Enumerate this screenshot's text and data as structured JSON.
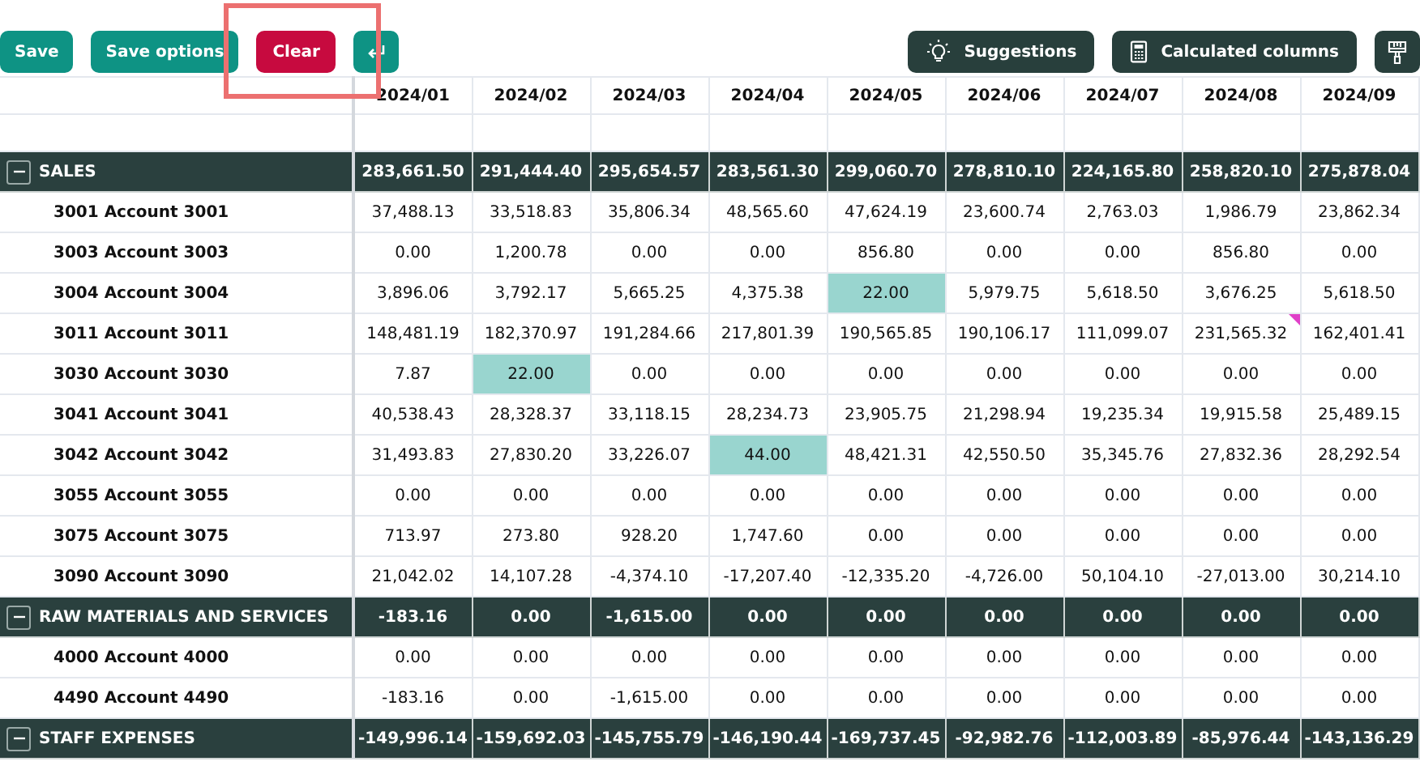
{
  "toolbar": {
    "left_buttons": [
      {
        "label": "Save",
        "kind": "primary",
        "highlighted": false
      },
      {
        "label": "Save options",
        "kind": "primary",
        "highlighted": false
      },
      {
        "label": "Clear",
        "kind": "danger",
        "highlighted": true
      },
      {
        "kind": "return-icon",
        "highlighted": false
      }
    ],
    "right_buttons": [
      {
        "label": "Suggestions",
        "kind": "bulb",
        "highlighted": false
      },
      {
        "label": "Calculated columns",
        "kind": "calculator",
        "highlighted": false
      },
      {
        "kind": "brush",
        "highlighted": false
      }
    ]
  },
  "table": {
    "columns": [
      "2024/01",
      "2024/02",
      "2024/03",
      "2024/04",
      "2024/05",
      "2024/06",
      "2024/07",
      "2024/08",
      "2024/09"
    ],
    "rows": [
      {
        "kind": "group",
        "label": "SALES",
        "expanded": true,
        "cells": [
          {
            "value": "283,661.50",
            "edited": false,
            "note": false
          },
          {
            "value": "291,444.40",
            "edited": false,
            "note": false
          },
          {
            "value": "295,654.57",
            "edited": false,
            "note": false
          },
          {
            "value": "283,561.30",
            "edited": false,
            "note": false
          },
          {
            "value": "299,060.70",
            "edited": false,
            "note": false
          },
          {
            "value": "278,810.10",
            "edited": false,
            "note": false
          },
          {
            "value": "224,165.80",
            "edited": false,
            "note": false
          },
          {
            "value": "258,820.10",
            "edited": false,
            "note": false
          },
          {
            "value": "275,878.04",
            "edited": false,
            "note": false
          }
        ]
      },
      {
        "kind": "account",
        "label": "3001 Account 3001",
        "cells": [
          {
            "value": "37,488.13",
            "edited": false,
            "note": false
          },
          {
            "value": "33,518.83",
            "edited": false,
            "note": false
          },
          {
            "value": "35,806.34",
            "edited": false,
            "note": false
          },
          {
            "value": "48,565.60",
            "edited": false,
            "note": false
          },
          {
            "value": "47,624.19",
            "edited": false,
            "note": false
          },
          {
            "value": "23,600.74",
            "edited": false,
            "note": false
          },
          {
            "value": "2,763.03",
            "edited": false,
            "note": false
          },
          {
            "value": "1,986.79",
            "edited": false,
            "note": false
          },
          {
            "value": "23,862.34",
            "edited": false,
            "note": false
          }
        ]
      },
      {
        "kind": "account",
        "label": "3003 Account 3003",
        "cells": [
          {
            "value": "0.00",
            "edited": false,
            "note": false
          },
          {
            "value": "1,200.78",
            "edited": false,
            "note": false
          },
          {
            "value": "0.00",
            "edited": false,
            "note": false
          },
          {
            "value": "0.00",
            "edited": false,
            "note": false
          },
          {
            "value": "856.80",
            "edited": false,
            "note": false
          },
          {
            "value": "0.00",
            "edited": false,
            "note": false
          },
          {
            "value": "0.00",
            "edited": false,
            "note": false
          },
          {
            "value": "856.80",
            "edited": false,
            "note": false
          },
          {
            "value": "0.00",
            "edited": false,
            "note": false
          }
        ]
      },
      {
        "kind": "account",
        "label": "3004 Account 3004",
        "cells": [
          {
            "value": "3,896.06",
            "edited": false,
            "note": false
          },
          {
            "value": "3,792.17",
            "edited": false,
            "note": false
          },
          {
            "value": "5,665.25",
            "edited": false,
            "note": false
          },
          {
            "value": "4,375.38",
            "edited": false,
            "note": false
          },
          {
            "value": "22.00",
            "edited": true,
            "note": false
          },
          {
            "value": "5,979.75",
            "edited": false,
            "note": false
          },
          {
            "value": "5,618.50",
            "edited": false,
            "note": false
          },
          {
            "value": "3,676.25",
            "edited": false,
            "note": false
          },
          {
            "value": "5,618.50",
            "edited": false,
            "note": false
          }
        ]
      },
      {
        "kind": "account",
        "label": "3011 Account 3011",
        "cells": [
          {
            "value": "148,481.19",
            "edited": false,
            "note": false
          },
          {
            "value": "182,370.97",
            "edited": false,
            "note": false
          },
          {
            "value": "191,284.66",
            "edited": false,
            "note": false
          },
          {
            "value": "217,801.39",
            "edited": false,
            "note": false
          },
          {
            "value": "190,565.85",
            "edited": false,
            "note": false
          },
          {
            "value": "190,106.17",
            "edited": false,
            "note": false
          },
          {
            "value": "111,099.07",
            "edited": false,
            "note": false
          },
          {
            "value": "231,565.32",
            "edited": false,
            "note": true
          },
          {
            "value": "162,401.41",
            "edited": false,
            "note": false
          }
        ]
      },
      {
        "kind": "account",
        "label": "3030 Account 3030",
        "cells": [
          {
            "value": "7.87",
            "edited": false,
            "note": false
          },
          {
            "value": "22.00",
            "edited": true,
            "note": false
          },
          {
            "value": "0.00",
            "edited": false,
            "note": false
          },
          {
            "value": "0.00",
            "edited": false,
            "note": false
          },
          {
            "value": "0.00",
            "edited": false,
            "note": false
          },
          {
            "value": "0.00",
            "edited": false,
            "note": false
          },
          {
            "value": "0.00",
            "edited": false,
            "note": false
          },
          {
            "value": "0.00",
            "edited": false,
            "note": false
          },
          {
            "value": "0.00",
            "edited": false,
            "note": false
          }
        ]
      },
      {
        "kind": "account",
        "label": "3041 Account 3041",
        "cells": [
          {
            "value": "40,538.43",
            "edited": false,
            "note": false
          },
          {
            "value": "28,328.37",
            "edited": false,
            "note": false
          },
          {
            "value": "33,118.15",
            "edited": false,
            "note": false
          },
          {
            "value": "28,234.73",
            "edited": false,
            "note": false
          },
          {
            "value": "23,905.75",
            "edited": false,
            "note": false
          },
          {
            "value": "21,298.94",
            "edited": false,
            "note": false
          },
          {
            "value": "19,235.34",
            "edited": false,
            "note": false
          },
          {
            "value": "19,915.58",
            "edited": false,
            "note": false
          },
          {
            "value": "25,489.15",
            "edited": false,
            "note": false
          }
        ]
      },
      {
        "kind": "account",
        "label": "3042 Account 3042",
        "cells": [
          {
            "value": "31,493.83",
            "edited": false,
            "note": false
          },
          {
            "value": "27,830.20",
            "edited": false,
            "note": false
          },
          {
            "value": "33,226.07",
            "edited": false,
            "note": false
          },
          {
            "value": "44.00",
            "edited": true,
            "note": false
          },
          {
            "value": "48,421.31",
            "edited": false,
            "note": false
          },
          {
            "value": "42,550.50",
            "edited": false,
            "note": false
          },
          {
            "value": "35,345.76",
            "edited": false,
            "note": false
          },
          {
            "value": "27,832.36",
            "edited": false,
            "note": false
          },
          {
            "value": "28,292.54",
            "edited": false,
            "note": false
          }
        ]
      },
      {
        "kind": "account",
        "label": "3055 Account 3055",
        "cells": [
          {
            "value": "0.00",
            "edited": false,
            "note": false
          },
          {
            "value": "0.00",
            "edited": false,
            "note": false
          },
          {
            "value": "0.00",
            "edited": false,
            "note": false
          },
          {
            "value": "0.00",
            "edited": false,
            "note": false
          },
          {
            "value": "0.00",
            "edited": false,
            "note": false
          },
          {
            "value": "0.00",
            "edited": false,
            "note": false
          },
          {
            "value": "0.00",
            "edited": false,
            "note": false
          },
          {
            "value": "0.00",
            "edited": false,
            "note": false
          },
          {
            "value": "0.00",
            "edited": false,
            "note": false
          }
        ]
      },
      {
        "kind": "account",
        "label": "3075 Account 3075",
        "cells": [
          {
            "value": "713.97",
            "edited": false,
            "note": false
          },
          {
            "value": "273.80",
            "edited": false,
            "note": false
          },
          {
            "value": "928.20",
            "edited": false,
            "note": false
          },
          {
            "value": "1,747.60",
            "edited": false,
            "note": false
          },
          {
            "value": "0.00",
            "edited": false,
            "note": false
          },
          {
            "value": "0.00",
            "edited": false,
            "note": false
          },
          {
            "value": "0.00",
            "edited": false,
            "note": false
          },
          {
            "value": "0.00",
            "edited": false,
            "note": false
          },
          {
            "value": "0.00",
            "edited": false,
            "note": false
          }
        ]
      },
      {
        "kind": "account",
        "label": "3090 Account 3090",
        "cells": [
          {
            "value": "21,042.02",
            "edited": false,
            "note": false
          },
          {
            "value": "14,107.28",
            "edited": false,
            "note": false
          },
          {
            "value": "-4,374.10",
            "edited": false,
            "note": false
          },
          {
            "value": "-17,207.40",
            "edited": false,
            "note": false
          },
          {
            "value": "-12,335.20",
            "edited": false,
            "note": false
          },
          {
            "value": "-4,726.00",
            "edited": false,
            "note": false
          },
          {
            "value": "50,104.10",
            "edited": false,
            "note": false
          },
          {
            "value": "-27,013.00",
            "edited": false,
            "note": false
          },
          {
            "value": "30,214.10",
            "edited": false,
            "note": false
          }
        ]
      },
      {
        "kind": "group",
        "label": "RAW MATERIALS AND SERVICES",
        "expanded": true,
        "cells": [
          {
            "value": "-183.16",
            "edited": false,
            "note": false
          },
          {
            "value": "0.00",
            "edited": false,
            "note": false
          },
          {
            "value": "-1,615.00",
            "edited": false,
            "note": false
          },
          {
            "value": "0.00",
            "edited": false,
            "note": false
          },
          {
            "value": "0.00",
            "edited": false,
            "note": false
          },
          {
            "value": "0.00",
            "edited": false,
            "note": false
          },
          {
            "value": "0.00",
            "edited": false,
            "note": false
          },
          {
            "value": "0.00",
            "edited": false,
            "note": false
          },
          {
            "value": "0.00",
            "edited": false,
            "note": false
          }
        ]
      },
      {
        "kind": "account",
        "label": "4000 Account 4000",
        "cells": [
          {
            "value": "0.00",
            "edited": false,
            "note": false
          },
          {
            "value": "0.00",
            "edited": false,
            "note": false
          },
          {
            "value": "0.00",
            "edited": false,
            "note": false
          },
          {
            "value": "0.00",
            "edited": false,
            "note": false
          },
          {
            "value": "0.00",
            "edited": false,
            "note": false
          },
          {
            "value": "0.00",
            "edited": false,
            "note": false
          },
          {
            "value": "0.00",
            "edited": false,
            "note": false
          },
          {
            "value": "0.00",
            "edited": false,
            "note": false
          },
          {
            "value": "0.00",
            "edited": false,
            "note": false
          }
        ]
      },
      {
        "kind": "account",
        "label": "4490 Account 4490",
        "cells": [
          {
            "value": "-183.16",
            "edited": false,
            "note": false
          },
          {
            "value": "0.00",
            "edited": false,
            "note": false
          },
          {
            "value": "-1,615.00",
            "edited": false,
            "note": false
          },
          {
            "value": "0.00",
            "edited": false,
            "note": false
          },
          {
            "value": "0.00",
            "edited": false,
            "note": false
          },
          {
            "value": "0.00",
            "edited": false,
            "note": false
          },
          {
            "value": "0.00",
            "edited": false,
            "note": false
          },
          {
            "value": "0.00",
            "edited": false,
            "note": false
          },
          {
            "value": "0.00",
            "edited": false,
            "note": false
          }
        ]
      },
      {
        "kind": "group",
        "label": "STAFF EXPENSES",
        "expanded": true,
        "cells": [
          {
            "value": "-149,996.14",
            "edited": false,
            "note": false
          },
          {
            "value": "-159,692.03",
            "edited": false,
            "note": false
          },
          {
            "value": "-145,755.79",
            "edited": false,
            "note": false
          },
          {
            "value": "-146,190.44",
            "edited": false,
            "note": false
          },
          {
            "value": "-169,737.45",
            "edited": false,
            "note": false
          },
          {
            "value": "-92,982.76",
            "edited": false,
            "note": false
          },
          {
            "value": "-112,003.89",
            "edited": false,
            "note": false
          },
          {
            "value": "-85,976.44",
            "edited": false,
            "note": false
          },
          {
            "value": "-143,136.29",
            "edited": false,
            "note": false
          }
        ]
      }
    ]
  }
}
